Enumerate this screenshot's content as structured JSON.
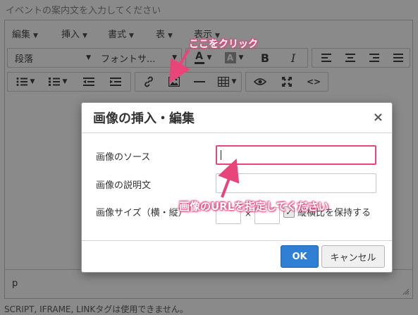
{
  "page": {
    "placeholder_hint": "イベントの案内文を入力してください",
    "footer_note": "SCRIPT, IFRAME, LINKタグは使用できません。"
  },
  "menubar": [
    {
      "label": "編集",
      "icon": "chevron-down-icon"
    },
    {
      "label": "挿入",
      "icon": "chevron-down-icon"
    },
    {
      "label": "書式",
      "icon": "chevron-down-icon"
    },
    {
      "label": "表",
      "icon": "chevron-down-icon"
    },
    {
      "label": "表示",
      "icon": "chevron-down-icon"
    }
  ],
  "toolbar": {
    "block_format": "段落",
    "font_family": "フォントサ...",
    "text_color_label": "A",
    "bg_color_label": "A",
    "bold_label": "B",
    "italic_label": "I",
    "icons": [
      "text-color-icon",
      "background-color-icon",
      "bold-icon",
      "italic-icon",
      "align-left-icon",
      "align-center-icon",
      "align-right-icon",
      "align-justify-icon",
      "bullet-list-icon",
      "numbered-list-icon",
      "outdent-icon",
      "indent-icon",
      "link-icon",
      "image-icon",
      "horizontal-rule-icon",
      "table-icon",
      "preview-icon",
      "fullscreen-icon",
      "code-icon"
    ]
  },
  "editor": {
    "status_path": "p"
  },
  "dialog": {
    "title": "画像の挿入・編集",
    "close_label": "×",
    "source_label": "画像のソース",
    "source_value": "",
    "description_label": "画像の説明文",
    "description_value": "",
    "size_label": "画像サイズ（横・縦）",
    "size_separator": "×",
    "keep_ratio_label": "縦横比を保持する",
    "keep_ratio_checked": true,
    "ok_label": "OK",
    "cancel_label": "キャンセル"
  },
  "annotations": {
    "click_here": "ここをクリック",
    "enter_url": "画像のURLを指定してください",
    "color": "#e8457a"
  }
}
